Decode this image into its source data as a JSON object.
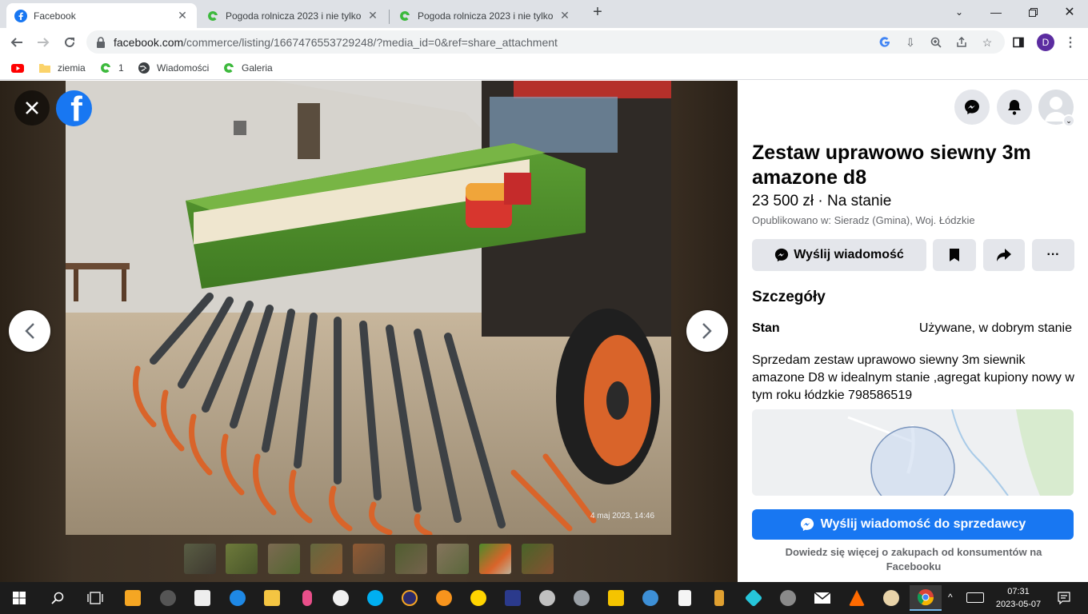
{
  "browser": {
    "tabs": [
      {
        "title": "Facebook",
        "active": true,
        "icon": "facebook-icon"
      },
      {
        "title": "Pogoda rolnicza 2023 i nie tylko",
        "active": false,
        "icon": "agro-icon"
      },
      {
        "title": "Pogoda rolnicza 2023 i nie tylko",
        "active": false,
        "icon": "agro-icon"
      }
    ],
    "url_host": "facebook.com",
    "url_path": "/commerce/listing/1667476553729248/?media_id=0&ref=share_attachment",
    "profile_initial": "D",
    "bookmarks": [
      {
        "label": "",
        "icon": "youtube-icon"
      },
      {
        "label": "ziemia",
        "icon": "folder-icon"
      },
      {
        "label": "1",
        "icon": "agro-icon"
      },
      {
        "label": "Wiadomości",
        "icon": "globe-icon"
      },
      {
        "label": "Galeria",
        "icon": "agro-icon"
      }
    ]
  },
  "viewer": {
    "photo_date": "4 maj 2023, 14:46",
    "thumbnail_count": 9,
    "active_thumbnail": 8
  },
  "listing": {
    "title": "Zestaw uprawowo siewny 3m amazone d8",
    "price_status": "23 500 zł · Na stanie",
    "location": "Opublikowano w: Sieradz (Gmina), Woj. Łódzkie",
    "send_message_label": "Wyślij wiadomość",
    "more_label": "···",
    "details_heading": "Szczegóły",
    "condition_label": "Stan",
    "condition_value": "Używane, w dobrym stanie",
    "description": "Sprzedam zestaw uprawowo siewny 3m siewnik amazone D8 w idealnym stanie ,agregat  kupiony nowy w tym roku łódzkie 798586519",
    "seller_button": "Wyślij wiadomość do sprzedawcy",
    "learn_more": "Dowiedz się więcej o zakupach od konsumentów na Facebooku"
  },
  "taskbar": {
    "time": "07:31",
    "date": "2023-05-07"
  },
  "colors": {
    "facebook_blue": "#1877f2",
    "machine_green": "#4c8a2a",
    "machine_orange": "#d9642a"
  }
}
